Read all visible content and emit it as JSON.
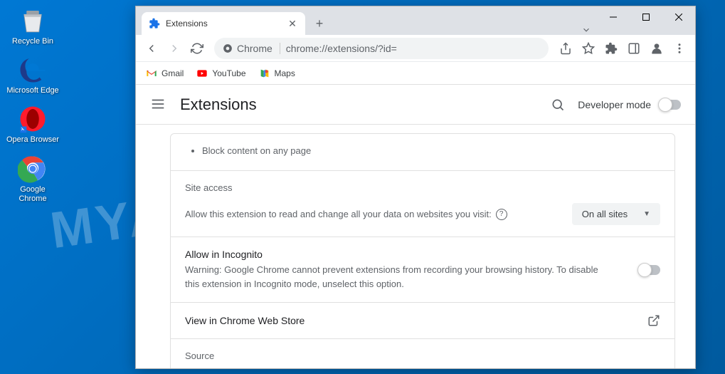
{
  "watermark": "MYANTISPYWARE.COM",
  "desktop": {
    "icons": [
      {
        "label": "Recycle Bin",
        "name": "recycle-bin"
      },
      {
        "label": "Microsoft Edge",
        "name": "microsoft-edge"
      },
      {
        "label": "Opera Browser",
        "name": "opera-browser"
      },
      {
        "label": "Google Chrome",
        "name": "google-chrome"
      }
    ]
  },
  "chrome": {
    "tab": {
      "title": "Extensions"
    },
    "omnibox": {
      "chip": "Chrome",
      "url": "chrome://extensions/?id="
    },
    "bookmarks": [
      {
        "label": "Gmail",
        "name": "gmail"
      },
      {
        "label": "YouTube",
        "name": "youtube"
      },
      {
        "label": "Maps",
        "name": "maps"
      }
    ]
  },
  "extensions_page": {
    "title": "Extensions",
    "dev_mode_label": "Developer mode",
    "permissions_bullet": "Block content on any page",
    "site_access": {
      "heading": "Site access",
      "description": "Allow this extension to read and change all your data on websites you visit:",
      "dropdown_value": "On all sites"
    },
    "incognito": {
      "title": "Allow in Incognito",
      "warning": "Warning: Google Chrome cannot prevent extensions from recording your browsing history. To disable this extension in Incognito mode, unselect this option."
    },
    "webstore_link": "View in Chrome Web Store",
    "source_heading": "Source"
  }
}
